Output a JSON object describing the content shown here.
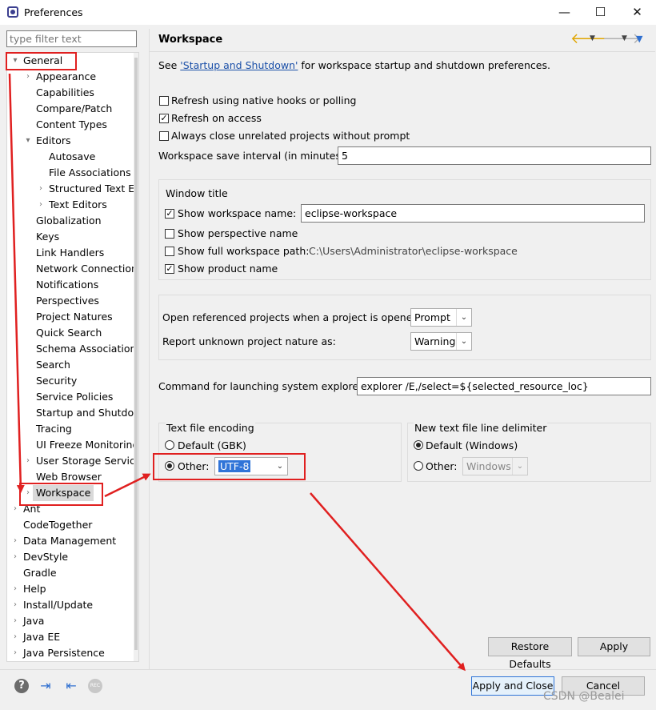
{
  "window": {
    "title": "Preferences",
    "controls": [
      "—",
      "☐",
      "✕"
    ]
  },
  "filter": {
    "placeholder": "type filter text"
  },
  "tree": [
    {
      "label": "General",
      "level": 0,
      "arrow": "▾"
    },
    {
      "label": "Appearance",
      "level": 1,
      "arrow": "›"
    },
    {
      "label": "Capabilities",
      "level": 1,
      "arrow": ""
    },
    {
      "label": "Compare/Patch",
      "level": 1,
      "arrow": ""
    },
    {
      "label": "Content Types",
      "level": 1,
      "arrow": ""
    },
    {
      "label": "Editors",
      "level": 1,
      "arrow": "▾"
    },
    {
      "label": "Autosave",
      "level": 2,
      "arrow": ""
    },
    {
      "label": "File Associations",
      "level": 2,
      "arrow": ""
    },
    {
      "label": "Structured Text Ed",
      "level": 2,
      "arrow": "›"
    },
    {
      "label": "Text Editors",
      "level": 2,
      "arrow": "›"
    },
    {
      "label": "Globalization",
      "level": 1,
      "arrow": ""
    },
    {
      "label": "Keys",
      "level": 1,
      "arrow": ""
    },
    {
      "label": "Link Handlers",
      "level": 1,
      "arrow": ""
    },
    {
      "label": "Network Connections",
      "level": 1,
      "arrow": ""
    },
    {
      "label": "Notifications",
      "level": 1,
      "arrow": ""
    },
    {
      "label": "Perspectives",
      "level": 1,
      "arrow": ""
    },
    {
      "label": "Project Natures",
      "level": 1,
      "arrow": ""
    },
    {
      "label": "Quick Search",
      "level": 1,
      "arrow": ""
    },
    {
      "label": "Schema Associations",
      "level": 1,
      "arrow": ""
    },
    {
      "label": "Search",
      "level": 1,
      "arrow": ""
    },
    {
      "label": "Security",
      "level": 1,
      "arrow": ""
    },
    {
      "label": "Service Policies",
      "level": 1,
      "arrow": ""
    },
    {
      "label": "Startup and Shutdow",
      "level": 1,
      "arrow": ""
    },
    {
      "label": "Tracing",
      "level": 1,
      "arrow": ""
    },
    {
      "label": "UI Freeze Monitoring",
      "level": 1,
      "arrow": ""
    },
    {
      "label": "User Storage Service",
      "level": 1,
      "arrow": "›"
    },
    {
      "label": "Web Browser",
      "level": 1,
      "arrow": ""
    },
    {
      "label": "Workspace",
      "level": 1,
      "arrow": "›",
      "selected": true
    },
    {
      "label": "Ant",
      "level": 0,
      "arrow": "›"
    },
    {
      "label": "CodeTogether",
      "level": 0,
      "arrow": ""
    },
    {
      "label": "Data Management",
      "level": 0,
      "arrow": "›"
    },
    {
      "label": "DevStyle",
      "level": 0,
      "arrow": "›"
    },
    {
      "label": "Gradle",
      "level": 0,
      "arrow": ""
    },
    {
      "label": "Help",
      "level": 0,
      "arrow": "›"
    },
    {
      "label": "Install/Update",
      "level": 0,
      "arrow": "›"
    },
    {
      "label": "Java",
      "level": 0,
      "arrow": "›"
    },
    {
      "label": "Java EE",
      "level": 0,
      "arrow": "›"
    },
    {
      "label": "Java Persistence",
      "level": 0,
      "arrow": "›"
    }
  ],
  "page": {
    "title": "Workspace",
    "see_prefix": "See ",
    "see_link": "'Startup and Shutdown'",
    "see_suffix": " for workspace startup and shutdown preferences.",
    "refresh_native": "Refresh using native hooks or polling",
    "refresh_access": "Refresh on access",
    "always_close": "Always close unrelated projects without prompt",
    "save_interval_label": "Workspace save interval (in minutes):",
    "save_interval_value": "5",
    "window_title_group": "Window title",
    "show_ws_name": "Show workspace name:",
    "ws_name_value": "eclipse-workspace",
    "show_perspective": "Show perspective name",
    "show_full_path": "Show full workspace path:",
    "full_path_value": "C:\\Users\\Administrator\\eclipse-workspace",
    "show_product": "Show product name",
    "open_ref_label": "Open referenced projects when a project is opened:",
    "open_ref_value": "Prompt",
    "report_unknown_label": "Report unknown project nature as:",
    "report_unknown_value": "Warning",
    "explorer_label": "Command for launching system explorer:",
    "explorer_value": "explorer /E,/select=${selected_resource_loc}",
    "encoding_group": "Text file encoding",
    "encoding_default": "Default (GBK)",
    "encoding_other": "Other:",
    "encoding_value": "UTF-8",
    "delimiter_group": "New text file line delimiter",
    "delimiter_default": "Default (Windows)",
    "delimiter_other": "Other:",
    "delimiter_value": "Windows"
  },
  "checks": {
    "refresh_native": false,
    "refresh_access": true,
    "always_close": false,
    "show_ws_name": true,
    "show_perspective": false,
    "show_full_path": false,
    "show_product": true
  },
  "buttons": {
    "restore_defaults": "Restore Defaults",
    "apply": "Apply",
    "apply_close": "Apply and Close",
    "cancel": "Cancel"
  },
  "footer_icons": [
    "help-icon",
    "import-icon",
    "export-icon",
    "record-icon"
  ],
  "footer_record_label": "REC",
  "watermark": "CSDN @Bealei",
  "colors": {
    "accent": "#1a4fa8",
    "annotation": "#e02020",
    "selection": "#3074d8"
  }
}
